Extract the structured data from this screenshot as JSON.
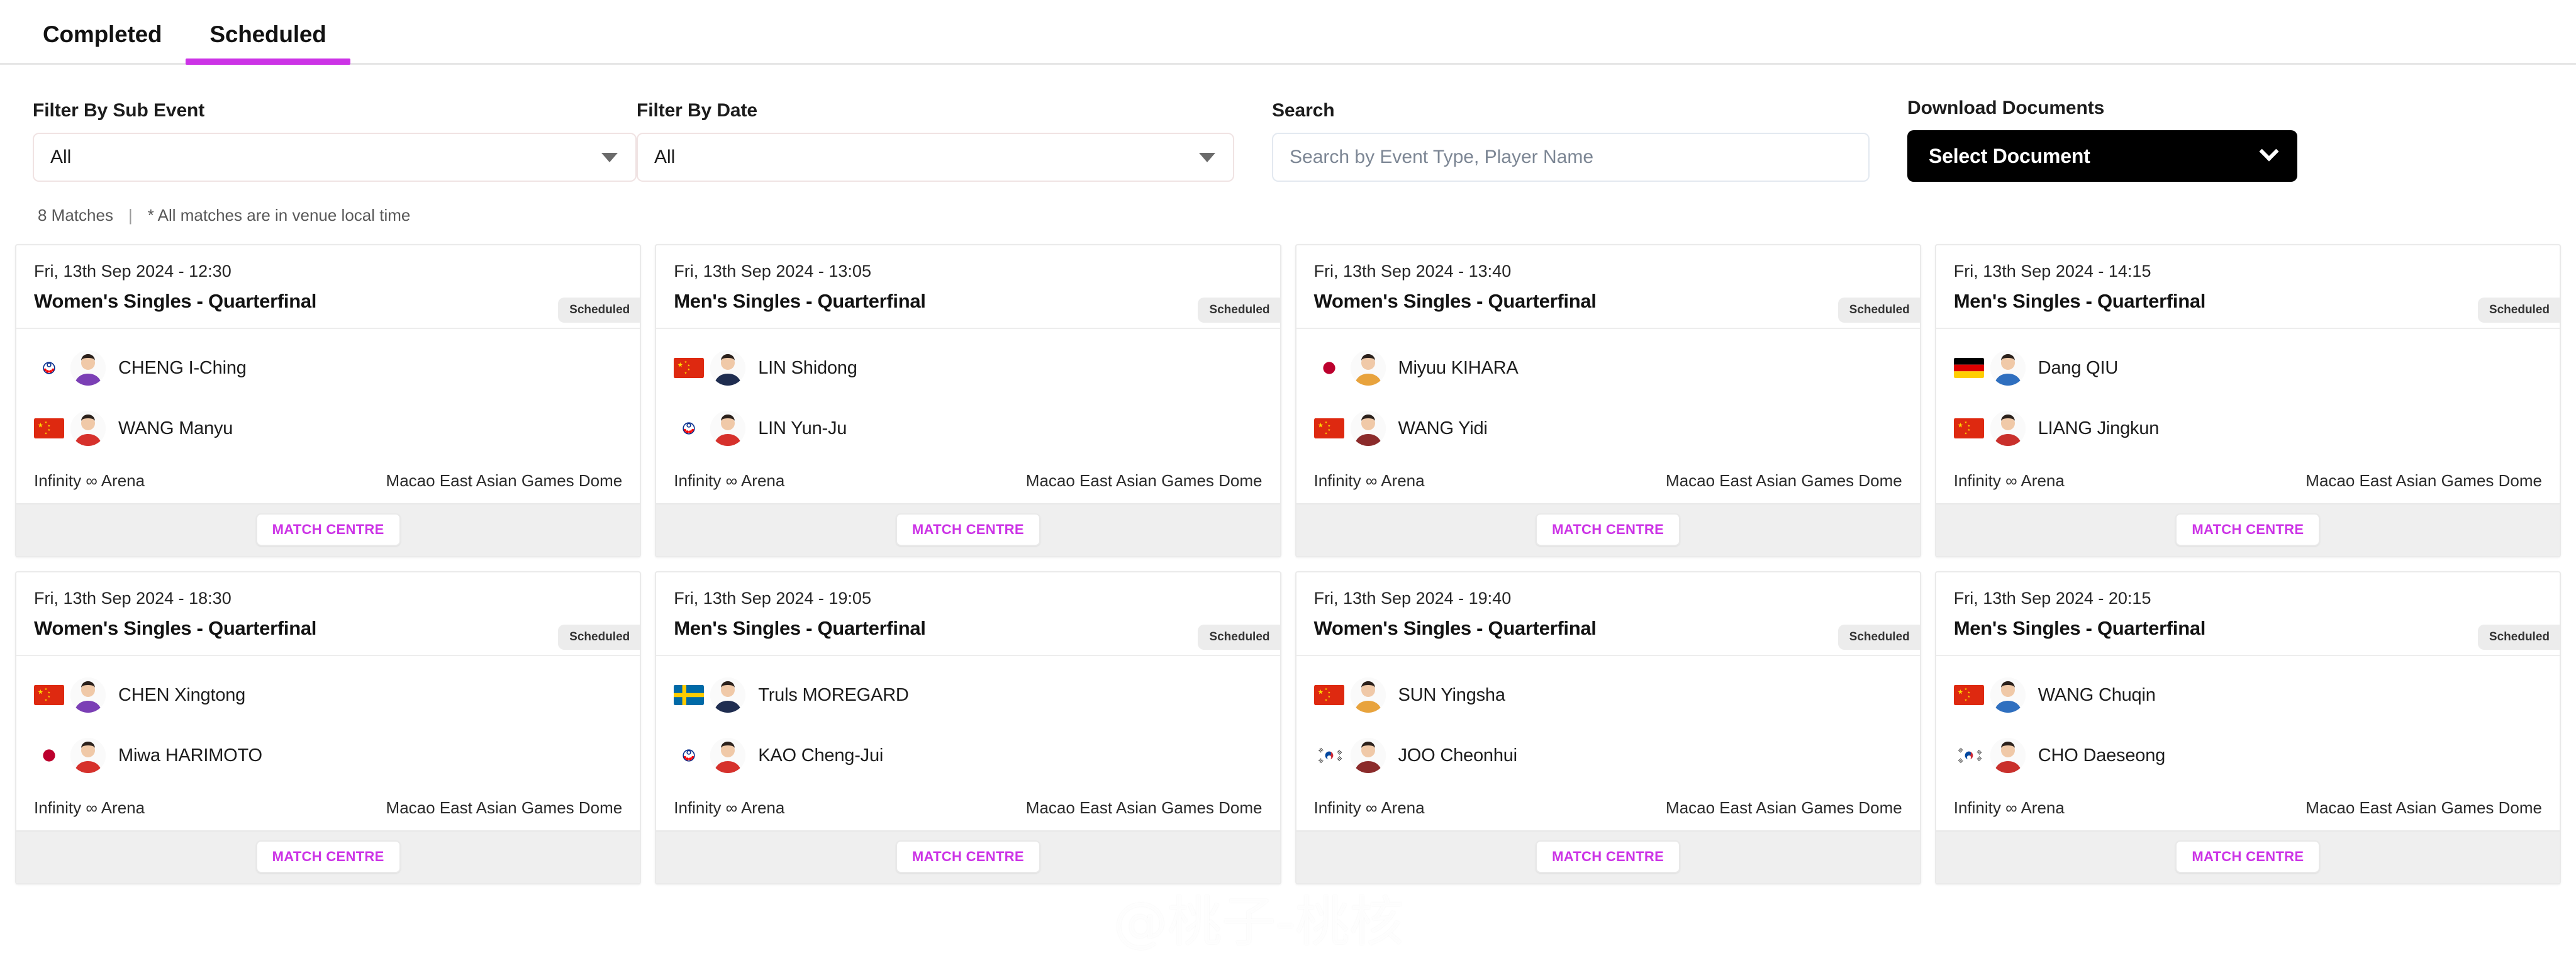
{
  "tabs": [
    {
      "label": "Completed",
      "active": false
    },
    {
      "label": "Scheduled",
      "active": true
    }
  ],
  "filters": {
    "sub_event": {
      "label": "Filter By Sub Event",
      "value": "All"
    },
    "date": {
      "label": "Filter By Date",
      "value": "All"
    },
    "search": {
      "label": "Search",
      "value": "",
      "placeholder": "Search by Event Type, Player Name"
    },
    "download": {
      "label": "Download Documents",
      "button_label": "Select Document"
    }
  },
  "summary": {
    "match_count": "8 Matches",
    "separator": "|",
    "note": "* All matches are in venue local time"
  },
  "labels": {
    "status": "Scheduled",
    "match_centre": "MATCH CENTRE",
    "hall": "Infinity ∞ Arena",
    "venue": "Macao East Asian Games Dome"
  },
  "colors": {
    "accent": "#cc33e6",
    "badge_bg": "#ececec",
    "download_bg": "#000000",
    "card_border": "#eaeaea",
    "footer_bg": "#efefef"
  },
  "watermark": {
    "text": "@桃子-桃核",
    "logo": "weibo-logo"
  },
  "matches": [
    {
      "date": "Fri, 13th Sep 2024 - 12:30",
      "title": "Women's Singles - Quarterfinal",
      "status": "Scheduled",
      "hall": "Infinity ∞ Arena",
      "venue": "Macao East Asian Games Dome",
      "match_centre": "MATCH CENTRE",
      "players": [
        {
          "name": "CHENG I-Ching",
          "flag": "tpe-flag"
        },
        {
          "name": "WANG Manyu",
          "flag": "chn-flag"
        }
      ]
    },
    {
      "date": "Fri, 13th Sep 2024 - 13:05",
      "title": "Men's Singles - Quarterfinal",
      "status": "Scheduled",
      "hall": "Infinity ∞ Arena",
      "venue": "Macao East Asian Games Dome",
      "match_centre": "MATCH CENTRE",
      "players": [
        {
          "name": "LIN Shidong",
          "flag": "chn-flag"
        },
        {
          "name": "LIN Yun-Ju",
          "flag": "tpe-flag"
        }
      ]
    },
    {
      "date": "Fri, 13th Sep 2024 - 13:40",
      "title": "Women's Singles - Quarterfinal",
      "status": "Scheduled",
      "hall": "Infinity ∞ Arena",
      "venue": "Macao East Asian Games Dome",
      "match_centre": "MATCH CENTRE",
      "players": [
        {
          "name": "Miyuu KIHARA",
          "flag": "jpn-flag"
        },
        {
          "name": "WANG Yidi",
          "flag": "chn-flag"
        }
      ]
    },
    {
      "date": "Fri, 13th Sep 2024 - 14:15",
      "title": "Men's Singles - Quarterfinal",
      "status": "Scheduled",
      "hall": "Infinity ∞ Arena",
      "venue": "Macao East Asian Games Dome",
      "match_centre": "MATCH CENTRE",
      "players": [
        {
          "name": "Dang QIU",
          "flag": "ger-flag"
        },
        {
          "name": "LIANG Jingkun",
          "flag": "chn-flag"
        }
      ]
    },
    {
      "date": "Fri, 13th Sep 2024 - 18:30",
      "title": "Women's Singles - Quarterfinal",
      "status": "Scheduled",
      "hall": "Infinity ∞ Arena",
      "venue": "Macao East Asian Games Dome",
      "match_centre": "MATCH CENTRE",
      "players": [
        {
          "name": "CHEN Xingtong",
          "flag": "chn-flag"
        },
        {
          "name": "Miwa HARIMOTO",
          "flag": "jpn-flag"
        }
      ]
    },
    {
      "date": "Fri, 13th Sep 2024 - 19:05",
      "title": "Men's Singles - Quarterfinal",
      "status": "Scheduled",
      "hall": "Infinity ∞ Arena",
      "venue": "Macao East Asian Games Dome",
      "match_centre": "MATCH CENTRE",
      "players": [
        {
          "name": "Truls MOREGARD",
          "flag": "swe-flag"
        },
        {
          "name": "KAO Cheng-Jui",
          "flag": "tpe-flag"
        }
      ]
    },
    {
      "date": "Fri, 13th Sep 2024 - 19:40",
      "title": "Women's Singles - Quarterfinal",
      "status": "Scheduled",
      "hall": "Infinity ∞ Arena",
      "venue": "Macao East Asian Games Dome",
      "match_centre": "MATCH CENTRE",
      "players": [
        {
          "name": "SUN Yingsha",
          "flag": "chn-flag"
        },
        {
          "name": "JOO Cheonhui",
          "flag": "kor-flag"
        }
      ]
    },
    {
      "date": "Fri, 13th Sep 2024 - 20:15",
      "title": "Men's Singles - Quarterfinal",
      "status": "Scheduled",
      "hall": "Infinity ∞ Arena",
      "venue": "Macao East Asian Games Dome",
      "match_centre": "MATCH CENTRE",
      "players": [
        {
          "name": "WANG Chuqin",
          "flag": "chn-flag"
        },
        {
          "name": "CHO Daeseong",
          "flag": "kor-flag"
        }
      ]
    }
  ]
}
